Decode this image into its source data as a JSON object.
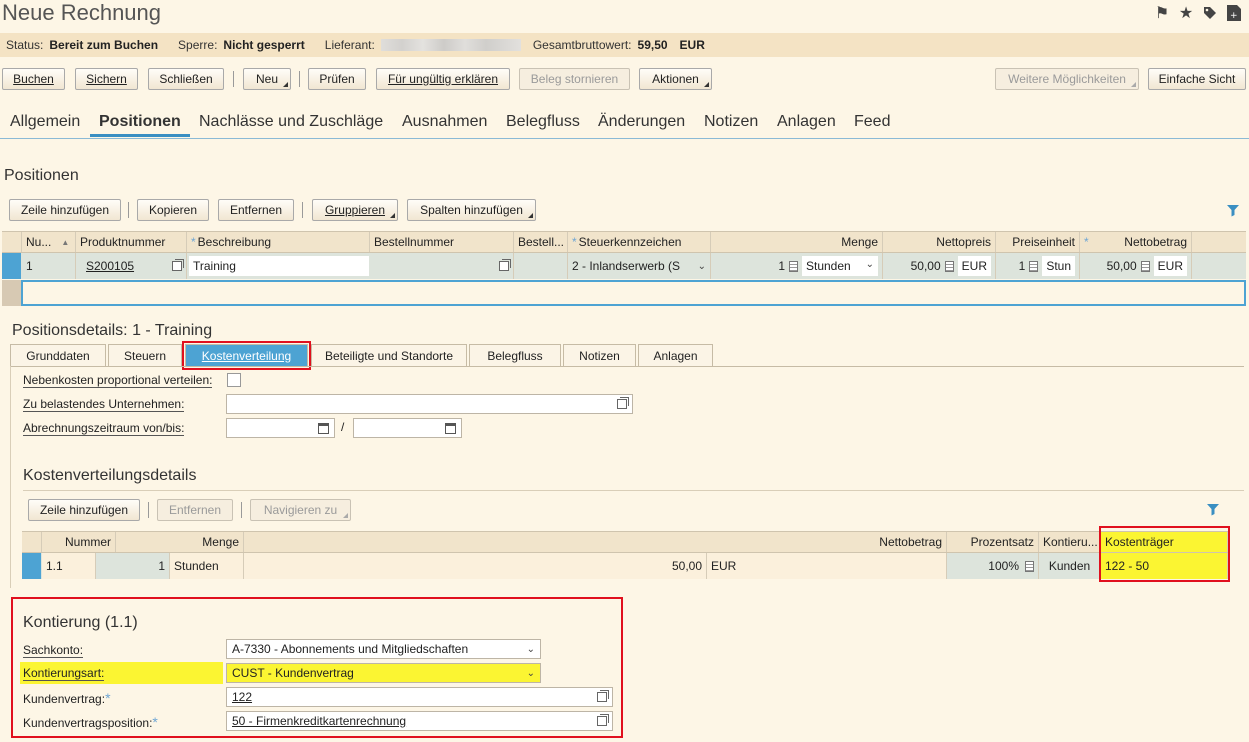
{
  "title": "Neue Rechnung",
  "status": {
    "status_label": "Status:",
    "status_value": "Bereit zum Buchen",
    "lock_label": "Sperre:",
    "lock_value": "Nicht gesperrt",
    "supplier_label": "Lieferant:",
    "gross_label": "Gesamtbruttowert:",
    "gross_value": "59,50",
    "gross_currency": "EUR"
  },
  "toolbar": {
    "buchen": "Buchen",
    "sichern": "Sichern",
    "schliessen": "Schließen",
    "neu": "Neu",
    "pruefen": "Prüfen",
    "ungueltig": "Für ungültig erklären",
    "stornieren": "Beleg stornieren",
    "aktionen": "Aktionen",
    "weitere": "Weitere Möglichkeiten",
    "einfache": "Einfache Sicht"
  },
  "main_tabs": [
    "Allgemein",
    "Positionen",
    "Nachlässe und Zuschläge",
    "Ausnahmen",
    "Belegfluss",
    "Änderungen",
    "Notizen",
    "Anlagen",
    "Feed"
  ],
  "positions": {
    "title": "Positionen",
    "buttons": {
      "add_row": "Zeile hinzufügen",
      "copy": "Kopieren",
      "remove": "Entfernen",
      "group": "Gruppieren",
      "add_cols": "Spalten hinzufügen"
    },
    "columns": [
      "Nu...",
      "Produktnummer",
      "Beschreibung",
      "Bestellnummer",
      "Bestell...",
      "Steuerkennzeichen",
      "Menge",
      "Nettopreis",
      "Preiseinheit",
      "Nettobetrag"
    ],
    "row": {
      "nr": "1",
      "product": "S200105",
      "description": "Training",
      "tax": "2 - Inlandserwerb (S",
      "qty": "1",
      "unit": "Stunden",
      "net_price": "50,00",
      "price_cur": "EUR",
      "price_unit_qty": "1",
      "price_unit": "Stun",
      "net_amount": "50,00",
      "amount_cur": "EUR"
    }
  },
  "details": {
    "title": "Positionsdetails: 1 - Training",
    "tabs": [
      "Grunddaten",
      "Steuern",
      "Kostenverteilung",
      "Beteiligte und Standorte",
      "Belegfluss",
      "Notizen",
      "Anlagen"
    ],
    "nebenkosten_label": "Nebenkosten proportional verteilen:",
    "unternehmen_label": "Zu belastendes Unternehmen:",
    "zeitraum_label": "Abrechnungszeitraum von/bis:",
    "zeitraum_sep": "/"
  },
  "cost": {
    "title": "Kostenverteilungsdetails",
    "buttons": {
      "add_row": "Zeile hinzufügen",
      "remove": "Entfernen",
      "navigate": "Navigieren zu"
    },
    "columns": [
      "Nummer",
      "Menge",
      "Nettobetrag",
      "Prozentsatz",
      "Kontieru...",
      "Kostenträger"
    ],
    "row": {
      "nr": "1.1",
      "qty": "1",
      "unit": "Stunden",
      "amount": "50,00",
      "cur": "EUR",
      "percent": "100%",
      "kontierung": "Kunden",
      "kostentraeger": "122 - 50"
    }
  },
  "kontierung": {
    "title": "Kontierung (1.1)",
    "sachkonto_label": "Sachkonto:",
    "sachkonto_value": "A-7330 - Abonnements und Mitgliedschaften",
    "art_label": "Kontierungsart:",
    "art_value": "CUST - Kundenvertrag",
    "vertrag_label": "Kundenvertrag:",
    "vertrag_value": "122",
    "position_label": "Kundenvertragsposition:",
    "position_value": "50 - Firmenkreditkartenrechnung"
  }
}
